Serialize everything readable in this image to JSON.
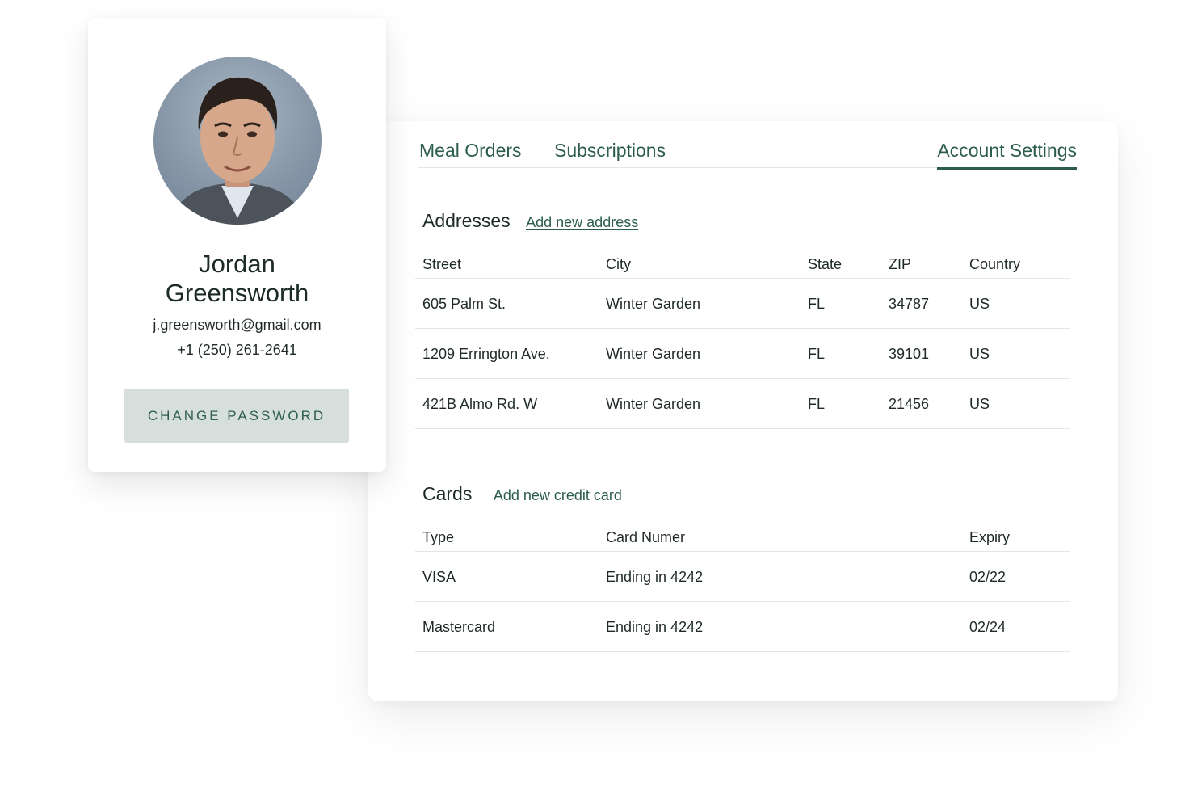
{
  "profile": {
    "name_line1": "Jordan",
    "name_line2": "Greensworth",
    "email": "j.greensworth@gmail.com",
    "phone": "+1 (250) 261-2641",
    "change_password_label": "CHANGE PASSWORD"
  },
  "tabs": {
    "meal_orders": "Meal Orders",
    "subscriptions": "Subscriptions",
    "account_settings": "Account Settings",
    "active": "account_settings"
  },
  "addresses": {
    "title": "Addresses",
    "add_link": "Add new address",
    "columns": [
      "Street",
      "City",
      "State",
      "ZIP",
      "Country"
    ],
    "rows": [
      [
        "605 Palm St.",
        "Winter Garden",
        "FL",
        "34787",
        "US"
      ],
      [
        "1209 Errington Ave.",
        "Winter Garden",
        "FL",
        "39101",
        "US"
      ],
      [
        "421B Almo Rd. W",
        "Winter Garden",
        "FL",
        "21456",
        "US"
      ]
    ]
  },
  "cards": {
    "title": "Cards",
    "add_link": "Add new credit card",
    "columns": [
      "Type",
      "Card Numer",
      "Expiry"
    ],
    "rows": [
      [
        "VISA",
        "Ending in 4242",
        "02/22"
      ],
      [
        "Mastercard",
        "Ending in 4242",
        "02/24"
      ]
    ]
  },
  "colors": {
    "accent": "#2c5d4b",
    "button_bg": "#d6dfdb",
    "text": "#1f2a26",
    "divider": "#e3e6e4"
  }
}
